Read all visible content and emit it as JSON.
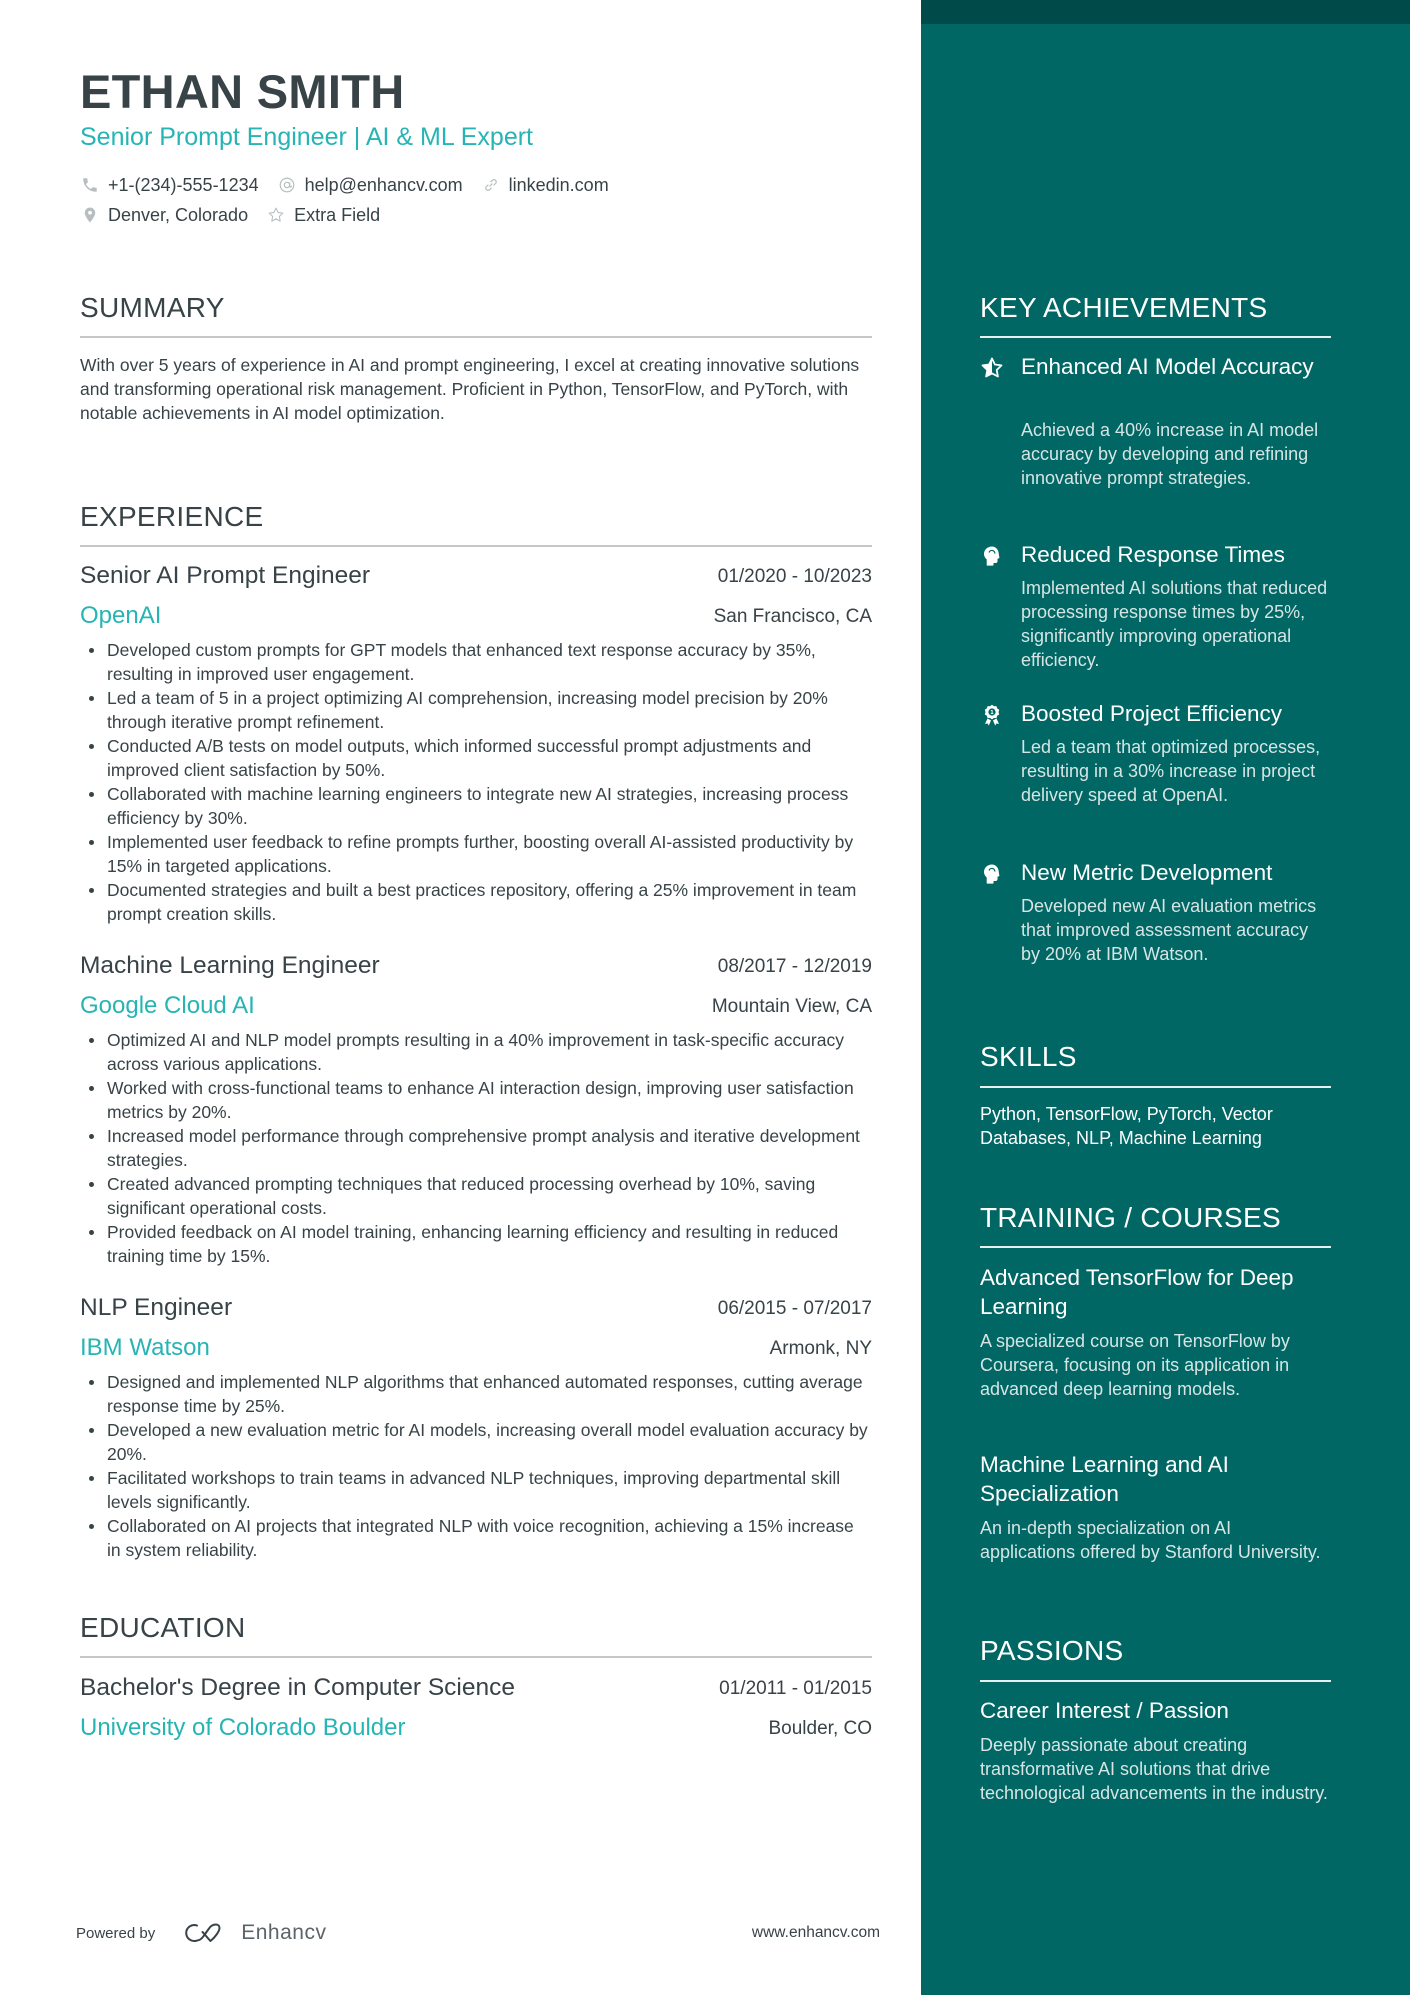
{
  "header": {
    "name": "ETHAN SMITH",
    "headline": "Senior Prompt Engineer | AI & ML Expert",
    "contacts": [
      {
        "icon": "phone-icon",
        "text": "+1-(234)-555-1234"
      },
      {
        "icon": "at-icon",
        "text": "help@enhancv.com"
      },
      {
        "icon": "link-icon",
        "text": "linkedin.com"
      },
      {
        "icon": "location-pin-icon",
        "text": "Denver, Colorado"
      },
      {
        "icon": "star-outline-icon",
        "text": "Extra Field"
      }
    ]
  },
  "summary": {
    "title": "SUMMARY",
    "text": "With over 5 years of experience in AI and prompt engineering, I excel at creating innovative solutions and transforming operational risk management. Proficient in Python, TensorFlow, and PyTorch, with notable achievements in AI model optimization."
  },
  "experience": {
    "title": "EXPERIENCE",
    "jobs": [
      {
        "title": "Senior AI Prompt Engineer",
        "dates": "01/2020 - 10/2023",
        "company": "OpenAI",
        "location": "San Francisco, CA",
        "bullets": [
          "Developed custom prompts for GPT models that enhanced text response accuracy by 35%, resulting in improved user engagement.",
          "Led a team of 5 in a project optimizing AI comprehension, increasing model precision by 20% through iterative prompt refinement.",
          "Conducted A/B tests on model outputs, which informed successful prompt adjustments and improved client satisfaction by 50%.",
          "Collaborated with machine learning engineers to integrate new AI strategies, increasing process efficiency by 30%.",
          "Implemented user feedback to refine prompts further, boosting overall AI-assisted productivity by 15% in targeted applications.",
          "Documented strategies and built a best practices repository, offering a 25% improvement in team prompt creation skills."
        ]
      },
      {
        "title": "Machine Learning Engineer",
        "dates": "08/2017 - 12/2019",
        "company": "Google Cloud AI",
        "location": "Mountain View, CA",
        "bullets": [
          "Optimized AI and NLP model prompts resulting in a 40% improvement in task-specific accuracy across various applications.",
          "Worked with cross-functional teams to enhance AI interaction design, improving user satisfaction metrics by 20%.",
          "Increased model performance through comprehensive prompt analysis and iterative development strategies.",
          "Created advanced prompting techniques that reduced processing overhead by 10%, saving significant operational costs.",
          "Provided feedback on AI model training, enhancing learning efficiency and resulting in reduced training time by 15%."
        ]
      },
      {
        "title": "NLP Engineer",
        "dates": "06/2015 - 07/2017",
        "company": "IBM Watson",
        "location": "Armonk, NY",
        "bullets": [
          "Designed and implemented NLP algorithms that enhanced automated responses, cutting average response time by 25%.",
          "Developed a new evaluation metric for AI models, increasing overall model evaluation accuracy by 20%.",
          "Facilitated workshops to train teams in advanced NLP techniques, improving departmental skill levels significantly.",
          "Collaborated on AI projects that integrated NLP with voice recognition, achieving a 15% increase in system reliability."
        ]
      }
    ]
  },
  "education": {
    "title": "EDUCATION",
    "items": [
      {
        "degree": "Bachelor's Degree in Computer Science",
        "dates": "01/2011 - 01/2015",
        "school": "University of Colorado Boulder",
        "location": "Boulder, CO"
      }
    ]
  },
  "footer": {
    "powered_by": "Powered by",
    "brand": "Enhancv",
    "site": "www.enhancv.com"
  },
  "sidebar": {
    "achievements": {
      "title": "KEY ACHIEVEMENTS",
      "items": [
        {
          "icon": "half-star-icon",
          "title": "Enhanced AI Model Accuracy",
          "desc": "Achieved a 40% increase in AI model accuracy by developing and refining innovative prompt strategies."
        },
        {
          "icon": "brain-head-icon",
          "title": "Reduced Response Times",
          "desc": "Implemented AI solutions that reduced processing response times by 25%, significantly improving operational efficiency."
        },
        {
          "icon": "award-ribbon-icon",
          "title": "Boosted Project Efficiency",
          "desc": "Led a team that optimized processes, resulting in a 30% increase in project delivery speed at OpenAI."
        },
        {
          "icon": "brain-head-icon",
          "title": "New Metric Development",
          "desc": "Developed new AI evaluation metrics that improved assessment accuracy by 20% at IBM Watson."
        }
      ]
    },
    "skills": {
      "title": "SKILLS",
      "text": "Python, TensorFlow, PyTorch, Vector Databases, NLP, Machine Learning"
    },
    "training": {
      "title": "TRAINING / COURSES",
      "items": [
        {
          "title": "Advanced TensorFlow for Deep Learning",
          "desc": "A specialized course on TensorFlow by Coursera, focusing on its application in advanced deep learning models."
        },
        {
          "title": "Machine Learning and AI Specialization",
          "desc": "An in-depth specialization on AI applications offered by Stanford University."
        }
      ]
    },
    "passions": {
      "title": "PASSIONS",
      "items": [
        {
          "title": "Career Interest / Passion",
          "desc": "Deeply passionate about creating transformative AI solutions that drive technological advancements in the industry."
        }
      ]
    }
  },
  "colors": {
    "accent": "#27b4b4",
    "sidebar_bg": "#006765",
    "sidebar_top": "#004a4a",
    "text": "#384347"
  }
}
